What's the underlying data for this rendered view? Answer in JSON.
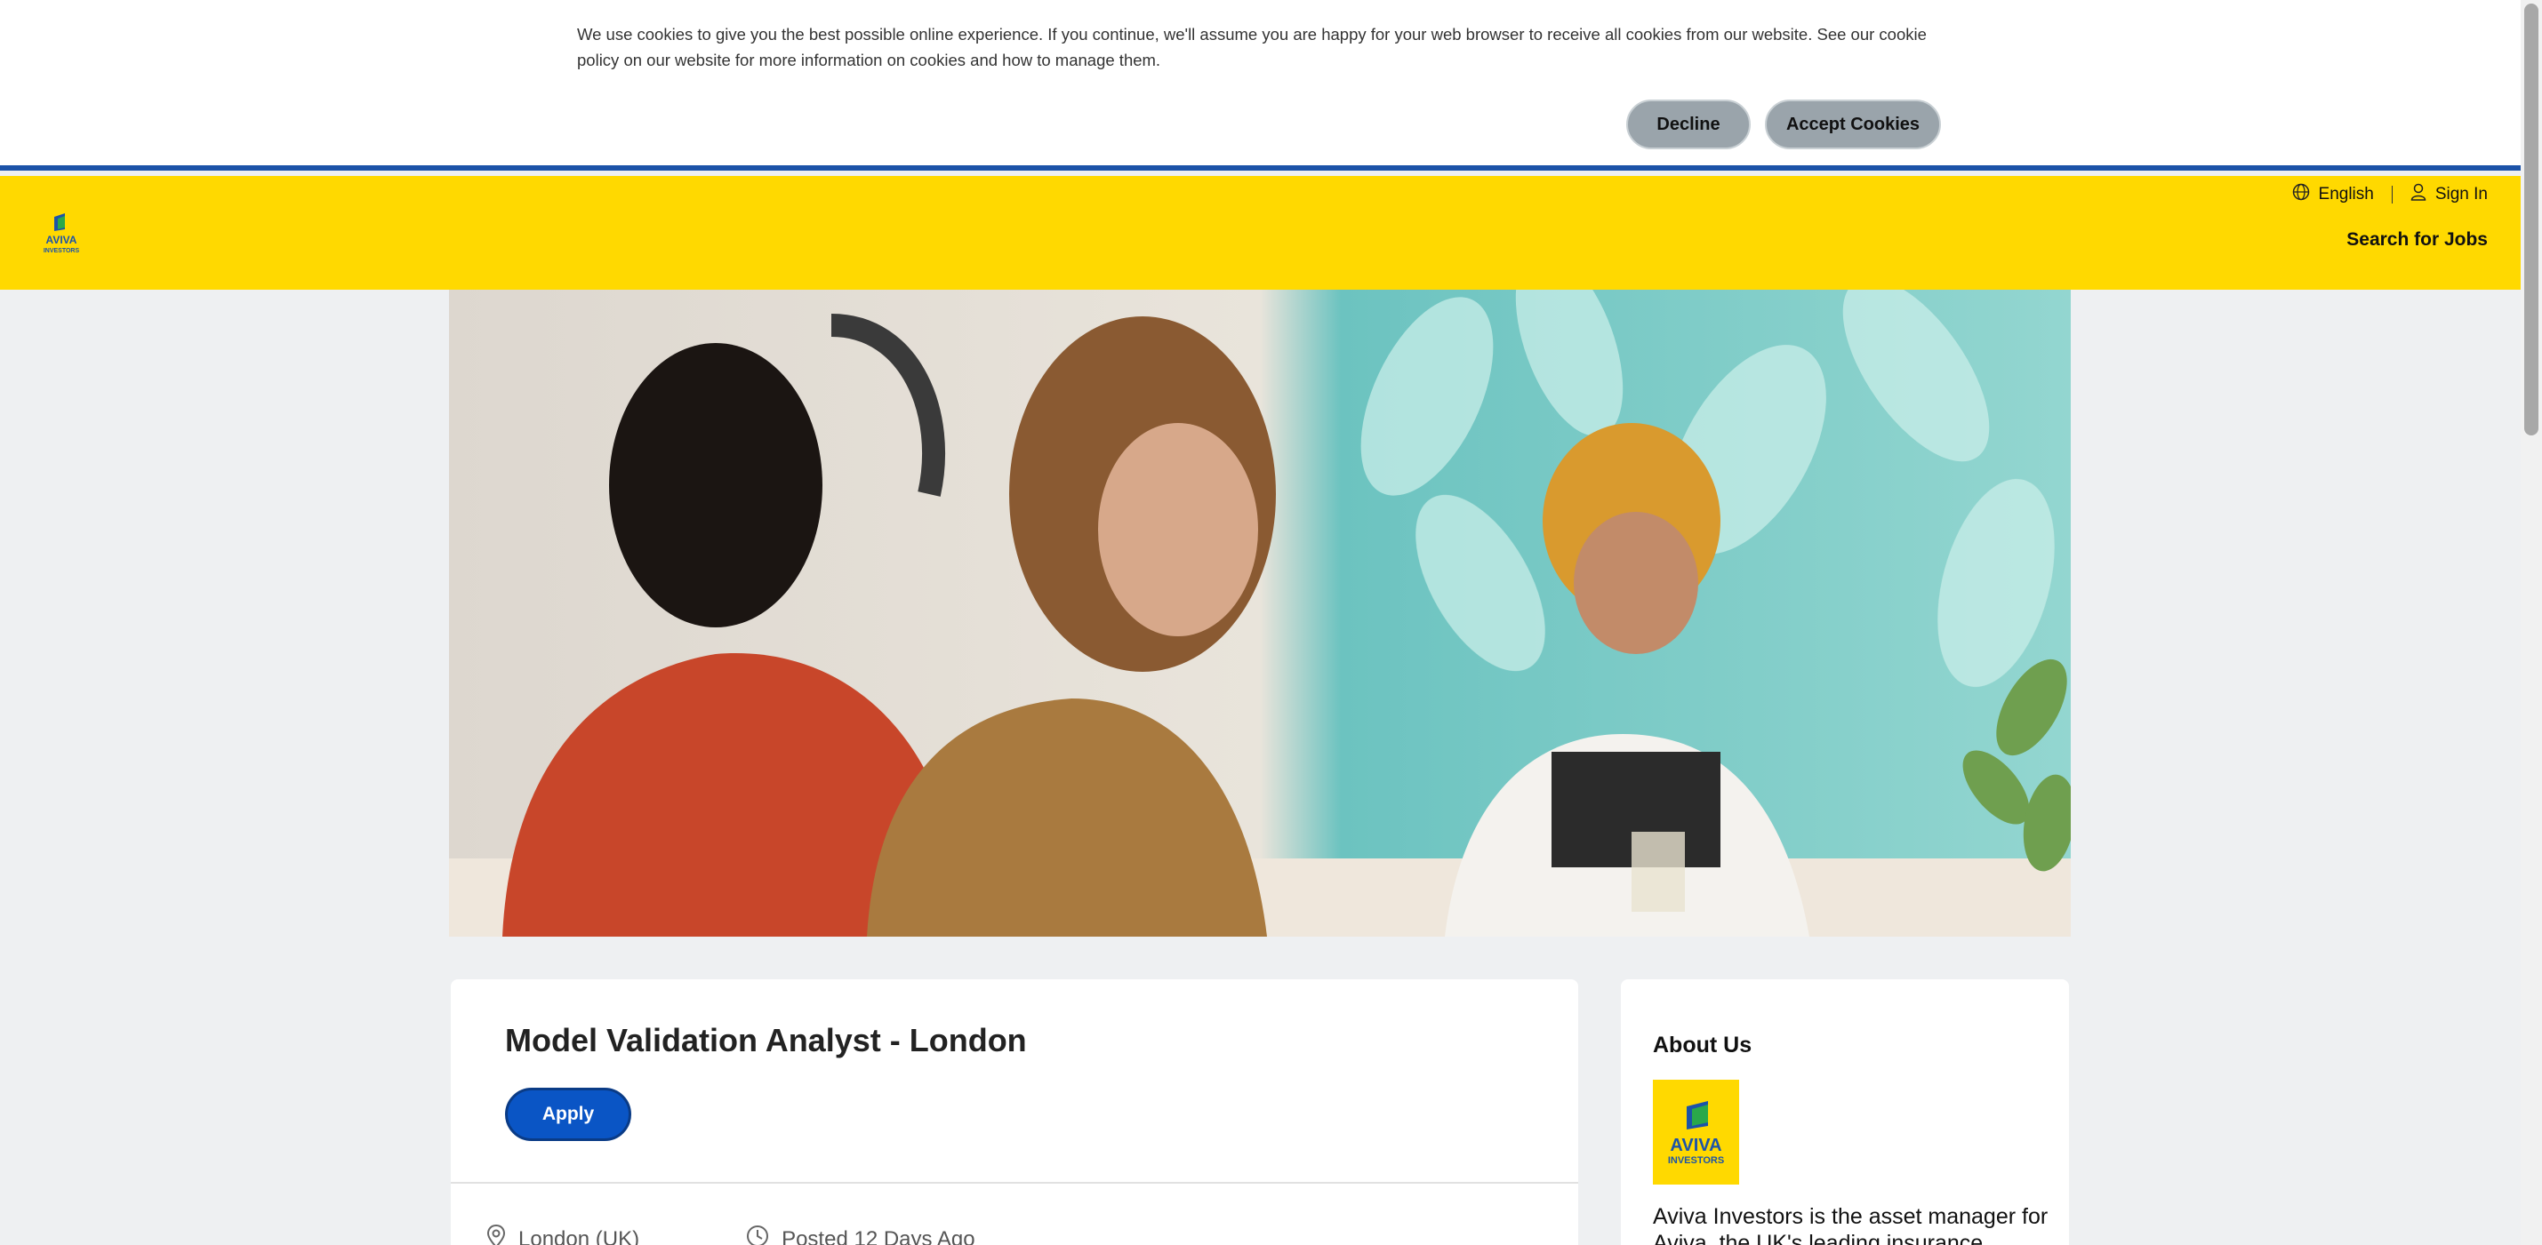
{
  "cookie_banner": {
    "text": "We use cookies to give you the best possible online experience. If you continue, we'll assume you are happy for your web browser to receive all cookies from our website. See our cookie policy on our website for more information on cookies and how to manage them.",
    "decline_label": "Decline",
    "accept_label": "Accept Cookies"
  },
  "header": {
    "logo_text_line1": "AVIVA",
    "logo_text_line2": "INVESTORS",
    "language_label": "English",
    "sign_in_label": "Sign In",
    "search_jobs_label": "Search for Jobs",
    "brand_color": "#ffd900"
  },
  "job": {
    "title": "Model Validation Analyst - London",
    "apply_label": "Apply",
    "location": "London (UK)",
    "posted": "Posted 12 Days Ago"
  },
  "about": {
    "title": "About Us",
    "logo_text_line1": "AVIVA",
    "logo_text_line2": "INVESTORS",
    "text": "Aviva Investors is the asset manager for Aviva, the UK's leading insurance, wealth"
  },
  "colors": {
    "accent_blue": "#0a55c5",
    "banner_border": "#1c53a8"
  }
}
